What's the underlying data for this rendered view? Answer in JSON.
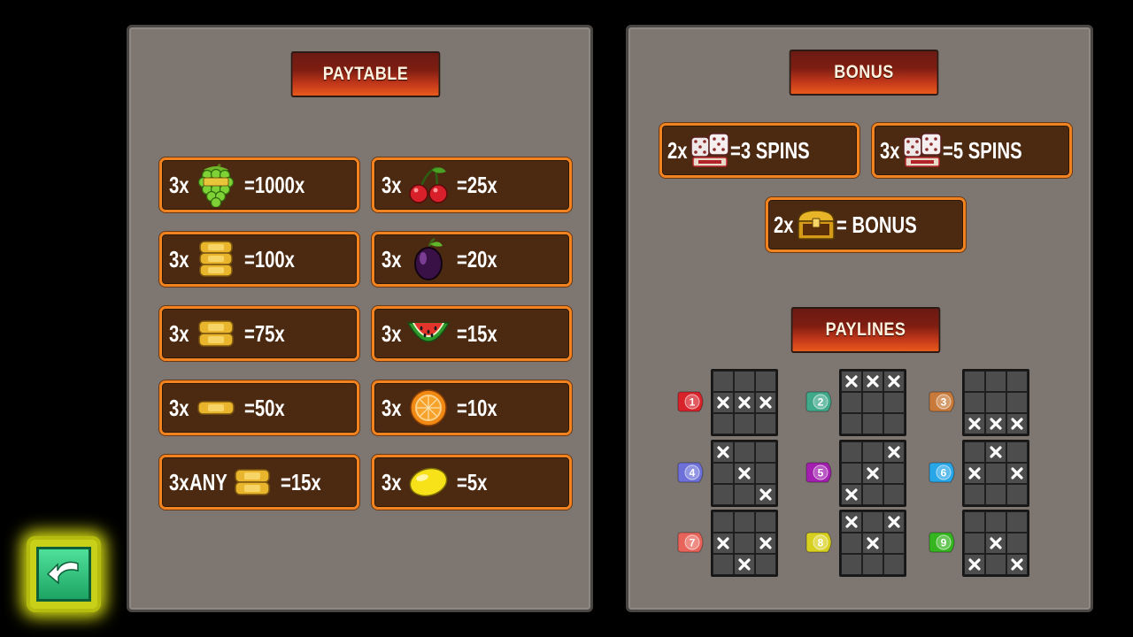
{
  "paytable": {
    "title": "PAYTABLE",
    "rows": [
      {
        "count": "3x",
        "icon": "grape-bunch-icon",
        "payout": "=1000x"
      },
      {
        "count": "3x",
        "icon": "cherries-icon",
        "payout": "=25x"
      },
      {
        "count": "3x",
        "icon": "gold-bars-3-icon",
        "payout": "=100x"
      },
      {
        "count": "3x",
        "icon": "plum-icon",
        "payout": "=20x"
      },
      {
        "count": "3x",
        "icon": "gold-bars-2-icon",
        "payout": "=75x"
      },
      {
        "count": "3x",
        "icon": "watermelon-icon",
        "payout": "=15x"
      },
      {
        "count": "3x",
        "icon": "gold-bar-icon",
        "payout": "=50x"
      },
      {
        "count": "3x",
        "icon": "orange-icon",
        "payout": "=10x"
      },
      {
        "count": "3x",
        "prefix": "ANY",
        "icon": "gold-bars-2-icon",
        "payout": "=15x"
      },
      {
        "count": "3x",
        "icon": "lemon-icon",
        "payout": "=5x"
      }
    ]
  },
  "bonus": {
    "title": "BONUS",
    "items": [
      {
        "count": "2x",
        "icon": "scatter-dice-icon",
        "result": "=3  SPINS"
      },
      {
        "count": "3x",
        "icon": "scatter-dice-icon",
        "result": "=5  SPINS"
      },
      {
        "count": "2x",
        "icon": "treasure-chest-icon",
        "result": "= BONUS"
      }
    ]
  },
  "paylines": {
    "title": "PAYLINES",
    "lines": [
      {
        "number": "1",
        "color": "#d8232a",
        "cells": [
          0,
          0,
          0,
          1,
          1,
          1,
          0,
          0,
          0
        ]
      },
      {
        "number": "2",
        "color": "#3fa98a",
        "cells": [
          1,
          1,
          1,
          0,
          0,
          0,
          0,
          0,
          0
        ]
      },
      {
        "number": "3",
        "color": "#c87a3a",
        "cells": [
          0,
          0,
          0,
          0,
          0,
          0,
          1,
          1,
          1
        ]
      },
      {
        "number": "4",
        "color": "#6c70d8",
        "cells": [
          1,
          0,
          0,
          0,
          1,
          0,
          0,
          0,
          1
        ]
      },
      {
        "number": "5",
        "color": "#a21fb0",
        "cells": [
          0,
          0,
          1,
          0,
          1,
          0,
          1,
          0,
          0
        ]
      },
      {
        "number": "6",
        "color": "#29a6e8",
        "cells": [
          0,
          1,
          0,
          1,
          0,
          1,
          0,
          0,
          0
        ]
      },
      {
        "number": "7",
        "color": "#e8645a",
        "cells": [
          0,
          0,
          0,
          1,
          0,
          1,
          0,
          1,
          0
        ]
      },
      {
        "number": "8",
        "color": "#d8d020",
        "cells": [
          1,
          0,
          1,
          0,
          1,
          0,
          0,
          0,
          0
        ]
      },
      {
        "number": "9",
        "color": "#35b51f",
        "cells": [
          0,
          0,
          0,
          0,
          1,
          0,
          1,
          0,
          1
        ]
      }
    ]
  },
  "navigation": {
    "back_icon": "back-arrow-icon"
  },
  "colors": {
    "panel": "#7d7671",
    "tile_bg": "#4c2a11",
    "tile_border": "#f08220",
    "header_gradient_top": "#6b1a12",
    "header_gradient_bottom": "#e85a1c",
    "back_glow": "#d9e013",
    "back_button": "#1da464"
  }
}
